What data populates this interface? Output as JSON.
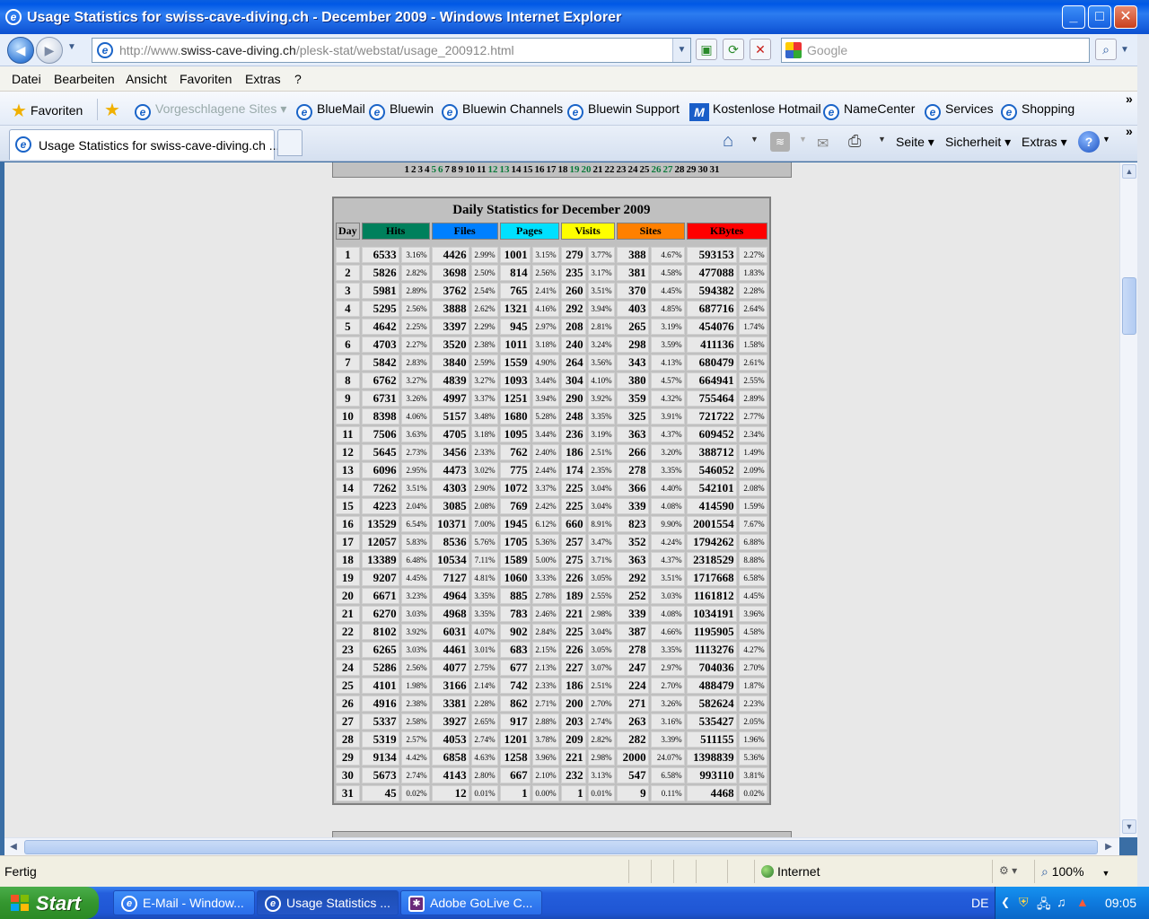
{
  "window": {
    "title": "Usage Statistics for swiss-cave-diving.ch - December 2009 - Windows Internet Explorer",
    "minimize": "_",
    "maximize": "□",
    "close": "✕"
  },
  "address": {
    "url_prefix": "http://www.",
    "url_domain": "swiss-cave-diving.ch",
    "url_path": "/plesk-stat/webstat/usage_200912.html"
  },
  "search": {
    "placeholder": "Google"
  },
  "menu": [
    "Datei",
    "Bearbeiten",
    "Ansicht",
    "Favoriten",
    "Extras",
    "?"
  ],
  "favorites": {
    "label": "Favoriten",
    "suggested": "Vorgeschlagene Sites",
    "items": [
      "BlueMail",
      "Bluewin",
      "Bluewin Channels",
      "Bluewin Support",
      "Kostenlose Hotmail",
      "NameCenter",
      "Services",
      "Shopping"
    ]
  },
  "tab": {
    "label": "Usage Statistics for swiss-cave-diving.ch ...",
    "tools": [
      "Seite",
      "Sicherheit",
      "Extras"
    ]
  },
  "daynav": {
    "days": [
      "1",
      "2",
      "3",
      "4",
      "5",
      "6",
      "7",
      "8",
      "9",
      "10",
      "11",
      "12",
      "13",
      "14",
      "15",
      "16",
      "17",
      "18",
      "19",
      "20",
      "21",
      "22",
      "23",
      "24",
      "25",
      "26",
      "27",
      "28",
      "29",
      "30",
      "31"
    ],
    "weekend": [
      "5",
      "6",
      "12",
      "13",
      "19",
      "20",
      "26",
      "27"
    ]
  },
  "table": {
    "caption": "Daily Statistics for December 2009",
    "headers": {
      "day": "Day",
      "hits": "Hits",
      "files": "Files",
      "pages": "Pages",
      "visits": "Visits",
      "sites": "Sites",
      "kbytes": "KBytes"
    },
    "colors": {
      "hits": "#00805c",
      "files": "#0080ff",
      "pages": "#00e0ff",
      "visits": "#ffff00",
      "sites": "#ff8000",
      "kbytes": "#ff0000",
      "grid": "#c0c0c0"
    },
    "rows": [
      [
        "1",
        "6533",
        "3.16%",
        "4426",
        "2.99%",
        "1001",
        "3.15%",
        "279",
        "3.77%",
        "388",
        "4.67%",
        "593153",
        "2.27%"
      ],
      [
        "2",
        "5826",
        "2.82%",
        "3698",
        "2.50%",
        "814",
        "2.56%",
        "235",
        "3.17%",
        "381",
        "4.58%",
        "477088",
        "1.83%"
      ],
      [
        "3",
        "5981",
        "2.89%",
        "3762",
        "2.54%",
        "765",
        "2.41%",
        "260",
        "3.51%",
        "370",
        "4.45%",
        "594382",
        "2.28%"
      ],
      [
        "4",
        "5295",
        "2.56%",
        "3888",
        "2.62%",
        "1321",
        "4.16%",
        "292",
        "3.94%",
        "403",
        "4.85%",
        "687716",
        "2.64%"
      ],
      [
        "5",
        "4642",
        "2.25%",
        "3397",
        "2.29%",
        "945",
        "2.97%",
        "208",
        "2.81%",
        "265",
        "3.19%",
        "454076",
        "1.74%"
      ],
      [
        "6",
        "4703",
        "2.27%",
        "3520",
        "2.38%",
        "1011",
        "3.18%",
        "240",
        "3.24%",
        "298",
        "3.59%",
        "411136",
        "1.58%"
      ],
      [
        "7",
        "5842",
        "2.83%",
        "3840",
        "2.59%",
        "1559",
        "4.90%",
        "264",
        "3.56%",
        "343",
        "4.13%",
        "680479",
        "2.61%"
      ],
      [
        "8",
        "6762",
        "3.27%",
        "4839",
        "3.27%",
        "1093",
        "3.44%",
        "304",
        "4.10%",
        "380",
        "4.57%",
        "664941",
        "2.55%"
      ],
      [
        "9",
        "6731",
        "3.26%",
        "4997",
        "3.37%",
        "1251",
        "3.94%",
        "290",
        "3.92%",
        "359",
        "4.32%",
        "755464",
        "2.89%"
      ],
      [
        "10",
        "8398",
        "4.06%",
        "5157",
        "3.48%",
        "1680",
        "5.28%",
        "248",
        "3.35%",
        "325",
        "3.91%",
        "721722",
        "2.77%"
      ],
      [
        "11",
        "7506",
        "3.63%",
        "4705",
        "3.18%",
        "1095",
        "3.44%",
        "236",
        "3.19%",
        "363",
        "4.37%",
        "609452",
        "2.34%"
      ],
      [
        "12",
        "5645",
        "2.73%",
        "3456",
        "2.33%",
        "762",
        "2.40%",
        "186",
        "2.51%",
        "266",
        "3.20%",
        "388712",
        "1.49%"
      ],
      [
        "13",
        "6096",
        "2.95%",
        "4473",
        "3.02%",
        "775",
        "2.44%",
        "174",
        "2.35%",
        "278",
        "3.35%",
        "546052",
        "2.09%"
      ],
      [
        "14",
        "7262",
        "3.51%",
        "4303",
        "2.90%",
        "1072",
        "3.37%",
        "225",
        "3.04%",
        "366",
        "4.40%",
        "542101",
        "2.08%"
      ],
      [
        "15",
        "4223",
        "2.04%",
        "3085",
        "2.08%",
        "769",
        "2.42%",
        "225",
        "3.04%",
        "339",
        "4.08%",
        "414590",
        "1.59%"
      ],
      [
        "16",
        "13529",
        "6.54%",
        "10371",
        "7.00%",
        "1945",
        "6.12%",
        "660",
        "8.91%",
        "823",
        "9.90%",
        "2001554",
        "7.67%"
      ],
      [
        "17",
        "12057",
        "5.83%",
        "8536",
        "5.76%",
        "1705",
        "5.36%",
        "257",
        "3.47%",
        "352",
        "4.24%",
        "1794262",
        "6.88%"
      ],
      [
        "18",
        "13389",
        "6.48%",
        "10534",
        "7.11%",
        "1589",
        "5.00%",
        "275",
        "3.71%",
        "363",
        "4.37%",
        "2318529",
        "8.88%"
      ],
      [
        "19",
        "9207",
        "4.45%",
        "7127",
        "4.81%",
        "1060",
        "3.33%",
        "226",
        "3.05%",
        "292",
        "3.51%",
        "1717668",
        "6.58%"
      ],
      [
        "20",
        "6671",
        "3.23%",
        "4964",
        "3.35%",
        "885",
        "2.78%",
        "189",
        "2.55%",
        "252",
        "3.03%",
        "1161812",
        "4.45%"
      ],
      [
        "21",
        "6270",
        "3.03%",
        "4968",
        "3.35%",
        "783",
        "2.46%",
        "221",
        "2.98%",
        "339",
        "4.08%",
        "1034191",
        "3.96%"
      ],
      [
        "22",
        "8102",
        "3.92%",
        "6031",
        "4.07%",
        "902",
        "2.84%",
        "225",
        "3.04%",
        "387",
        "4.66%",
        "1195905",
        "4.58%"
      ],
      [
        "23",
        "6265",
        "3.03%",
        "4461",
        "3.01%",
        "683",
        "2.15%",
        "226",
        "3.05%",
        "278",
        "3.35%",
        "1113276",
        "4.27%"
      ],
      [
        "24",
        "5286",
        "2.56%",
        "4077",
        "2.75%",
        "677",
        "2.13%",
        "227",
        "3.07%",
        "247",
        "2.97%",
        "704036",
        "2.70%"
      ],
      [
        "25",
        "4101",
        "1.98%",
        "3166",
        "2.14%",
        "742",
        "2.33%",
        "186",
        "2.51%",
        "224",
        "2.70%",
        "488479",
        "1.87%"
      ],
      [
        "26",
        "4916",
        "2.38%",
        "3381",
        "2.28%",
        "862",
        "2.71%",
        "200",
        "2.70%",
        "271",
        "3.26%",
        "582624",
        "2.23%"
      ],
      [
        "27",
        "5337",
        "2.58%",
        "3927",
        "2.65%",
        "917",
        "2.88%",
        "203",
        "2.74%",
        "263",
        "3.16%",
        "535427",
        "2.05%"
      ],
      [
        "28",
        "5319",
        "2.57%",
        "4053",
        "2.74%",
        "1201",
        "3.78%",
        "209",
        "2.82%",
        "282",
        "3.39%",
        "511155",
        "1.96%"
      ],
      [
        "29",
        "9134",
        "4.42%",
        "6858",
        "4.63%",
        "1258",
        "3.96%",
        "221",
        "2.98%",
        "2000",
        "24.07%",
        "1398839",
        "5.36%"
      ],
      [
        "30",
        "5673",
        "2.74%",
        "4143",
        "2.80%",
        "667",
        "2.10%",
        "232",
        "3.13%",
        "547",
        "6.58%",
        "993110",
        "3.81%"
      ],
      [
        "31",
        "45",
        "0.02%",
        "12",
        "0.01%",
        "1",
        "0.00%",
        "1",
        "0.01%",
        "9",
        "0.11%",
        "4468",
        "0.02%"
      ]
    ]
  },
  "status": {
    "text": "Fertig",
    "zone": "Internet",
    "zoom": "100%"
  },
  "taskbar": {
    "start": "Start",
    "buttons": [
      "E-Mail - Window...",
      "Usage Statistics ...",
      "Adobe GoLive C..."
    ],
    "lang": "DE",
    "clock": "09:05"
  }
}
